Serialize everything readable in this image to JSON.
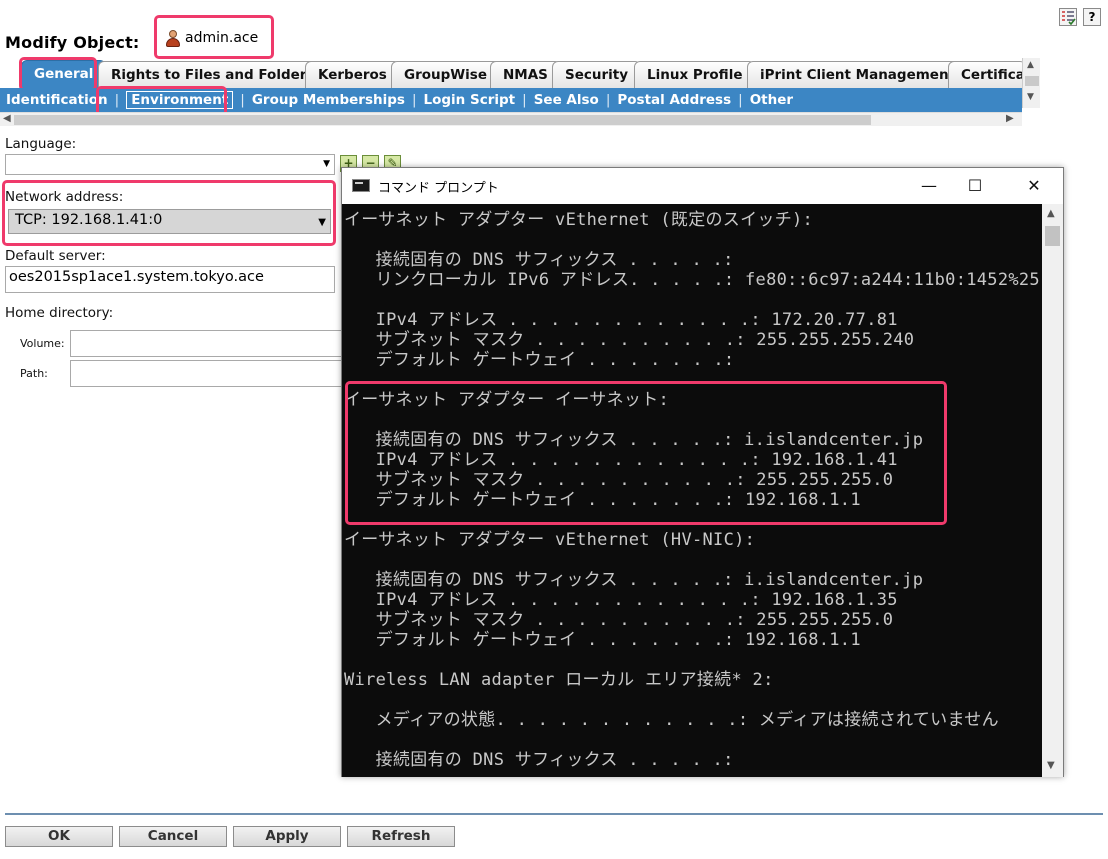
{
  "header": {
    "title": "Modify Object:",
    "object_name": "admin.ace",
    "icons": [
      "checklist-icon",
      "help-icon"
    ],
    "help_glyph": "?"
  },
  "tabs": [
    {
      "label": "General",
      "active": true
    },
    {
      "label": "Rights to Files and Folders"
    },
    {
      "label": "Kerberos"
    },
    {
      "label": "GroupWise"
    },
    {
      "label": "NMAS"
    },
    {
      "label": "Security"
    },
    {
      "label": "Linux Profile"
    },
    {
      "label": "iPrint Client Management"
    },
    {
      "label": "Certifica"
    }
  ],
  "subtabs": [
    {
      "label": "Identification"
    },
    {
      "label": "Environment",
      "active": true
    },
    {
      "label": "Group Memberships"
    },
    {
      "label": "Login Script"
    },
    {
      "label": "See Also"
    },
    {
      "label": "Postal Address"
    },
    {
      "label": "Other"
    }
  ],
  "separator": "|",
  "form": {
    "language_label": "Language:",
    "language_value": "",
    "network_label": "Network address:",
    "network_value": "TCP: 192.168.1.41:0",
    "server_label": "Default server:",
    "server_value": "oes2015sp1ace1.system.tokyo.ace",
    "home_label": "Home directory:",
    "volume_label": "Volume:",
    "volume_value": "",
    "path_label": "Path:",
    "path_value": "",
    "mini_buttons": [
      "+",
      "−",
      "✎"
    ]
  },
  "cmd": {
    "title": "コマンド プロンプト",
    "lines": [
      "イーサネット アダプター vEthernet (既定のスイッチ):",
      "",
      "   接続固有の DNS サフィックス . . . . .:",
      "   リンクローカル IPv6 アドレス. . . . .: fe80::6c97:a244:11b0:1452%25",
      "",
      "   IPv4 アドレス . . . . . . . . . . . .: 172.20.77.81",
      "   サブネット マスク . . . . . . . . . .: 255.255.255.240",
      "   デフォルト ゲートウェイ . . . . . . .:",
      "",
      "イーサネット アダプター イーサネット:",
      "",
      "   接続固有の DNS サフィックス . . . . .: i.islandcenter.jp",
      "   IPv4 アドレス . . . . . . . . . . . .: 192.168.1.41",
      "   サブネット マスク . . . . . . . . . .: 255.255.255.0",
      "   デフォルト ゲートウェイ . . . . . . .: 192.168.1.1",
      "",
      "イーサネット アダプター vEthernet (HV-NIC):",
      "",
      "   接続固有の DNS サフィックス . . . . .: i.islandcenter.jp",
      "   IPv4 アドレス . . . . . . . . . . . .: 192.168.1.35",
      "   サブネット マスク . . . . . . . . . .: 255.255.255.0",
      "   デフォルト ゲートウェイ . . . . . . .: 192.168.1.1",
      "",
      "Wireless LAN adapter ローカル エリア接続* 2:",
      "",
      "   メディアの状態. . . . . . . . . . . .: メディアは接続されていません",
      "",
      "   接続固有の DNS サフィックス . . . . .:"
    ],
    "window_buttons": [
      "—",
      "☐",
      "✕"
    ]
  },
  "buttons": {
    "ok": "OK",
    "cancel": "Cancel",
    "apply": "Apply",
    "refresh": "Refresh"
  },
  "colors": {
    "accent": "#3c86c4",
    "highlight": "#ef3a6b",
    "console_bg": "#0c0c0c",
    "console_fg": "#c8c8c8"
  }
}
